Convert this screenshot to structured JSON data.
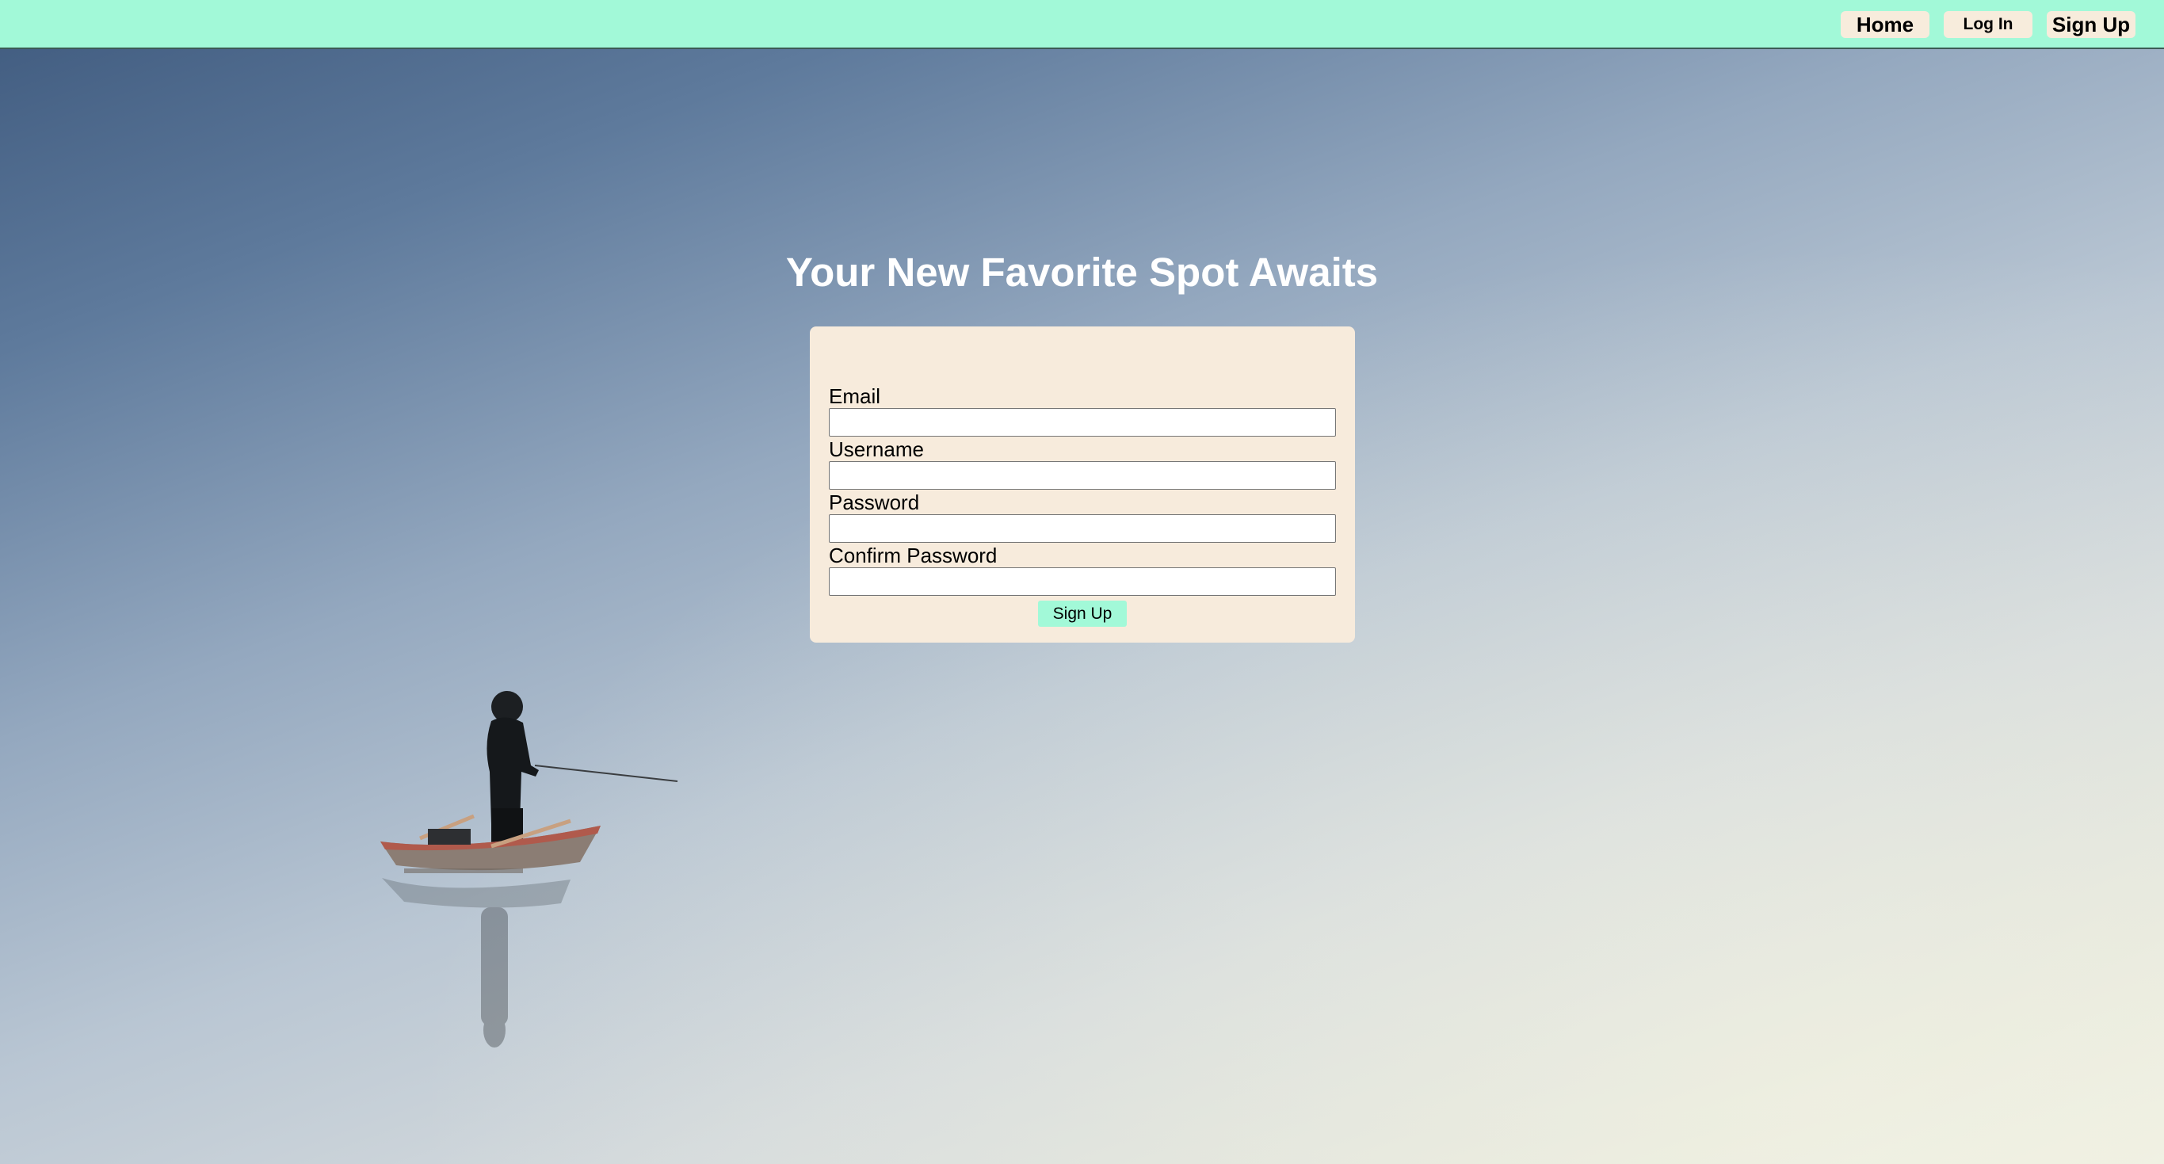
{
  "nav": {
    "home_label": "Home",
    "login_label": "Log In",
    "signup_label": "Sign Up"
  },
  "hero": {
    "title": "Your New Favorite Spot Awaits",
    "image": "person-fishing-in-rowboat-on-misty-lake"
  },
  "form": {
    "email_label": "Email",
    "email_value": "",
    "username_label": "Username",
    "username_value": "",
    "password_label": "Password",
    "password_value": "",
    "confirm_password_label": "Confirm Password",
    "confirm_password_value": "",
    "submit_label": "Sign Up"
  },
  "colors": {
    "accent": "#a2f9d8",
    "card_background": "#f7ebdc"
  }
}
